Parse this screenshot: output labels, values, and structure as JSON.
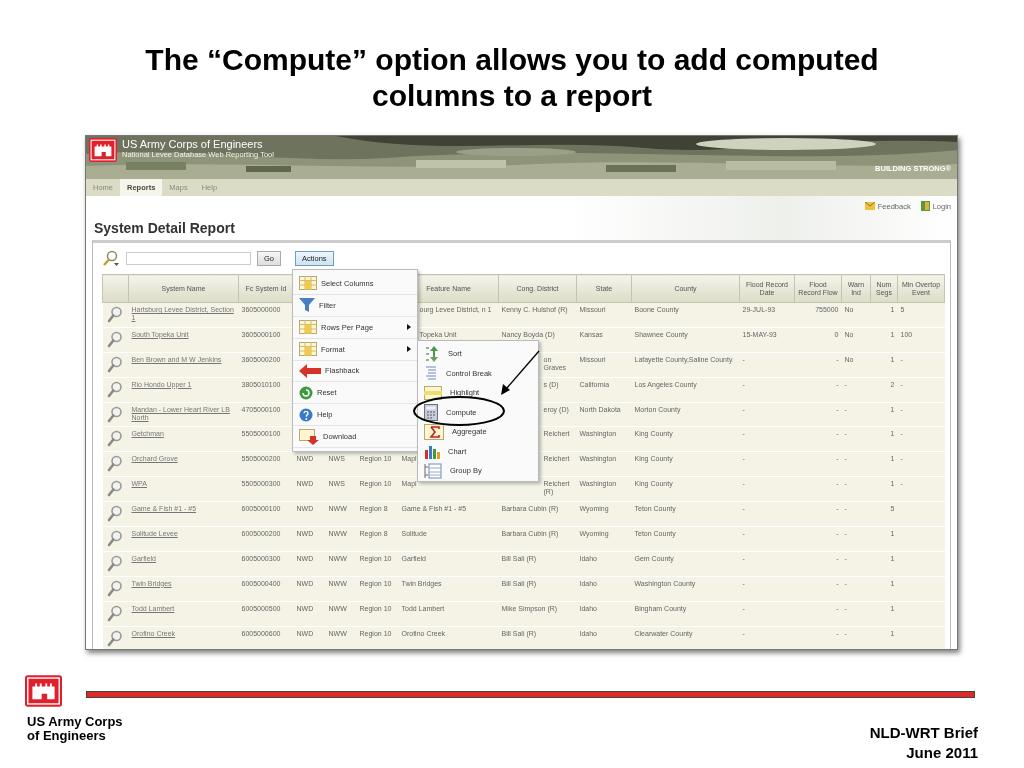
{
  "slide": {
    "title": "The “Compute” option allows you to add computed columns to a report"
  },
  "app": {
    "header": {
      "title": "US Army Corps of Engineers",
      "subtitle": "National Levee Database Web Reporting Tool",
      "tagline": "BUILDING STRONG®"
    },
    "nav": [
      {
        "label": "Home",
        "selected": false
      },
      {
        "label": "Reports",
        "selected": true
      },
      {
        "label": "Maps",
        "selected": false
      },
      {
        "label": "Help",
        "selected": false
      }
    ],
    "links": [
      "Feedback",
      "Login"
    ],
    "report_title": "System Detail Report",
    "search": {
      "button": "Go"
    },
    "actions_button": "Actions",
    "table": {
      "columns": [
        "System Name",
        "Fc System Id",
        null,
        null,
        null,
        "Feature Name",
        "Cong. District",
        "State",
        "County",
        "Flood Record Date",
        "Flood Record Flow",
        "Warn Ind",
        "Num Segs",
        "Min Overtop Event"
      ],
      "rows": [
        [
          "Hartsburg Levee District, Section 1",
          "3605000000",
          null,
          null,
          null,
          {
            "kind": "clipped",
            "text": "ourg Levee District, n 1"
          },
          "Kenny C. Hulshof (R)",
          "Missouri",
          "Boone County",
          "29-JUL-93",
          "755000",
          "No",
          "1",
          "5"
        ],
        [
          "South Topeka Unit",
          "3605000100",
          null,
          null,
          null,
          {
            "kind": "clipped",
            "text": "Topeka Unit"
          },
          "Nancy Boyda (D)",
          "Kansas",
          "Shawnee County",
          "15-MAY-93",
          "0",
          "No",
          "1",
          "100"
        ],
        [
          "Ben Brown and M W Jenkins",
          "3605000200",
          null,
          null,
          null,
          null,
          {
            "kind": "clipped",
            "text": "on Graves"
          },
          "Missouri",
          "Lafayette County,Saline County",
          "-",
          "-",
          "No",
          "1",
          "-"
        ],
        [
          "Rio Hondo Upper 1",
          "3805010100",
          null,
          null,
          null,
          null,
          {
            "kind": "clipped",
            "text": "s (D)"
          },
          "California",
          "Los Angeles County",
          "-",
          "-",
          "-",
          "2",
          "-"
        ],
        [
          "Mandan - Lower Heart River LB North",
          "4705000100",
          null,
          null,
          null,
          null,
          {
            "kind": "clipped",
            "text": "eroy (D)"
          },
          "North Dakota",
          "Morton County",
          "-",
          "-",
          "-",
          "1",
          "-"
        ],
        [
          "Getchman",
          "5505000100",
          null,
          null,
          null,
          null,
          {
            "kind": "clipped",
            "text": "Reichert"
          },
          "Washington",
          "King County",
          "-",
          "-",
          "-",
          "1",
          "-"
        ],
        [
          "Orchard Grove",
          "5505000200",
          "NWD",
          "NWS",
          "Region 10",
          "Mapl",
          {
            "kind": "clipped",
            "text": "Reichert"
          },
          "Washington",
          "King County",
          "-",
          "-",
          "-",
          "1",
          "-"
        ],
        [
          "WPA",
          "5505000300",
          "NWD",
          "NWS",
          "Region 10",
          "Mapl",
          {
            "kind": "clipped",
            "text": "Reichert (R)"
          },
          "Washington",
          "King County",
          "-",
          "-",
          "-",
          "1",
          "-"
        ],
        [
          "Game & Fish #1 - #5",
          "6005000100",
          "NWD",
          "NWW",
          "Region 8",
          "Game & Fish #1 - #5",
          "Barbara Cubin (R)",
          "Wyoming",
          "Teton County",
          "-",
          "-",
          "-",
          "5",
          null
        ],
        [
          "Solitude Levee",
          "6005000200",
          "NWD",
          "NWW",
          "Region 8",
          "Solitude",
          "Barbara Cubin (R)",
          "Wyoming",
          "Teton County",
          "-",
          "-",
          "-",
          "1",
          null
        ],
        [
          "Garfield",
          "6005000300",
          "NWD",
          "NWW",
          "Region 10",
          "Garfield",
          "Bill Sali (R)",
          "Idaho",
          "Gem County",
          "-",
          "-",
          "-",
          "1",
          null
        ],
        [
          "Twin Bridges",
          "6005000400",
          "NWD",
          "NWW",
          "Region 10",
          "Twin Bridges",
          "Bill Sali (R)",
          "Idaho",
          "Washington County",
          "-",
          "-",
          "-",
          "1",
          null
        ],
        [
          "Todd Lambert",
          "6005000500",
          "NWD",
          "NWW",
          "Region 10",
          "Todd Lambert",
          "Mike Simpson (R)",
          "Idaho",
          "Bingham County",
          "-",
          "-",
          "-",
          "1",
          null
        ],
        [
          "Orofino Creek",
          "6005000600",
          "NWD",
          "NWW",
          "Region 10",
          "Orofino Creek",
          "Bill Sali (R)",
          "Idaho",
          "Clearwater County",
          "-",
          "-",
          "-",
          "1",
          null
        ]
      ]
    },
    "actions_menu": [
      {
        "label": "Select Columns",
        "kind": "columns",
        "submenu": false
      },
      {
        "label": "Filter",
        "kind": "filter",
        "submenu": false
      },
      {
        "label": "Rows Per Page",
        "kind": "rows",
        "submenu": true
      },
      {
        "label": "Format",
        "kind": "format",
        "submenu": true
      },
      {
        "label": "Flashback",
        "kind": "flashback",
        "submenu": false
      },
      {
        "label": "Reset",
        "kind": "reset",
        "submenu": false
      },
      {
        "label": "Help",
        "kind": "help",
        "submenu": false
      },
      {
        "label": "Download",
        "kind": "download",
        "submenu": false
      }
    ],
    "format_submenu": [
      {
        "label": "Sort",
        "kind": "sort"
      },
      {
        "label": "Control Break",
        "kind": "break"
      },
      {
        "label": "Highlight",
        "kind": "highlight"
      },
      {
        "label": "Compute",
        "kind": "compute"
      },
      {
        "label": "Aggregate",
        "kind": "aggregate"
      },
      {
        "label": "Chart",
        "kind": "chart"
      },
      {
        "label": "Group By",
        "kind": "group"
      }
    ]
  },
  "footer": {
    "org": "US Army Corps of Engineers",
    "brief": "NLD-WRT Brief",
    "date": "June 2011"
  }
}
